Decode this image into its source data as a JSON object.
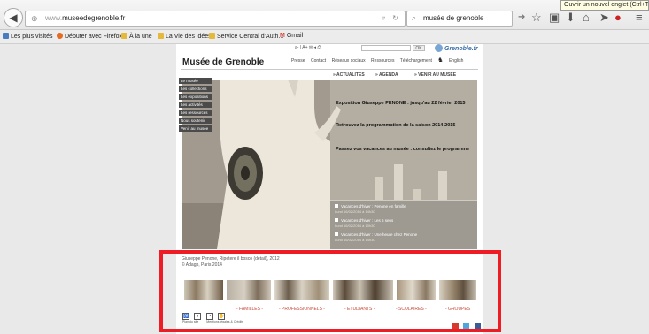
{
  "browser": {
    "url_prefix": "www.",
    "url_domain": "museedegrenoble.fr",
    "search_text": "musée de grenoble",
    "tooltip": "Ouvrir un nouvel onglet (Ctrl+T)",
    "bookmarks": [
      {
        "label": "Les plus visités"
      },
      {
        "label": "Débuter avec Firefox"
      },
      {
        "label": "À la une"
      },
      {
        "label": "La Vie des idées"
      },
      {
        "label": "Service Central d'Auth..."
      },
      {
        "label": "Gmail"
      }
    ]
  },
  "site": {
    "title": "Musée de Grenoble",
    "util_tools": "a- | A+  ✉  ◂  ⎙",
    "search_button": "OK",
    "logo_text": "Grenoble.fr",
    "top_nav": [
      "Presse",
      "Contact",
      "Réseaux sociaux",
      "Ressources",
      "Téléchargement",
      "English"
    ],
    "side_menu": [
      "Le musée",
      "Les collections",
      "Les expositions",
      "Les activités",
      "Les ressources",
      "Nous soutenir",
      "Venir au musée"
    ],
    "tabs": [
      "» ACTUALITÉS",
      "» AGENDA",
      "» VENIR AU MUSÉE"
    ],
    "news": [
      "Exposition Giuseppe PENONE : jusqu'au 22 février 2015",
      "Retrouvez la programmation de la saison 2014-2015",
      "Passez vos vacances au musée : consultez le programme"
    ],
    "events": [
      {
        "title": "Vacances d'hiver : Penone en famille",
        "date": "Lund 16/02/2014 à 14h30"
      },
      {
        "title": "Vacances d'hiver : Les 5 sens",
        "date": "Lund 16/02/2014 à 10h30"
      },
      {
        "title": "Vacances d'hiver : Une heure chez Penone",
        "date": "Lund 16/02/2014 à 14h30"
      }
    ],
    "caption_line1": "Giuseppe Penone, Ripetere il bosco (détail), 2012",
    "caption_line2": "© Adagp, Paris 2014",
    "audience_links": [
      "- FAMILLES -",
      "- PROFESSIONNELS -",
      "- ETUDIANTS -",
      "- SCOLAIRES -",
      "- GROUPES"
    ],
    "footer_links": [
      "Plan du site",
      "Mentions légales & Crédits"
    ]
  },
  "colors": {
    "highlight": "#ee1c25",
    "audience": "#c74a3a",
    "menu_bg": "#4b4b4b"
  }
}
